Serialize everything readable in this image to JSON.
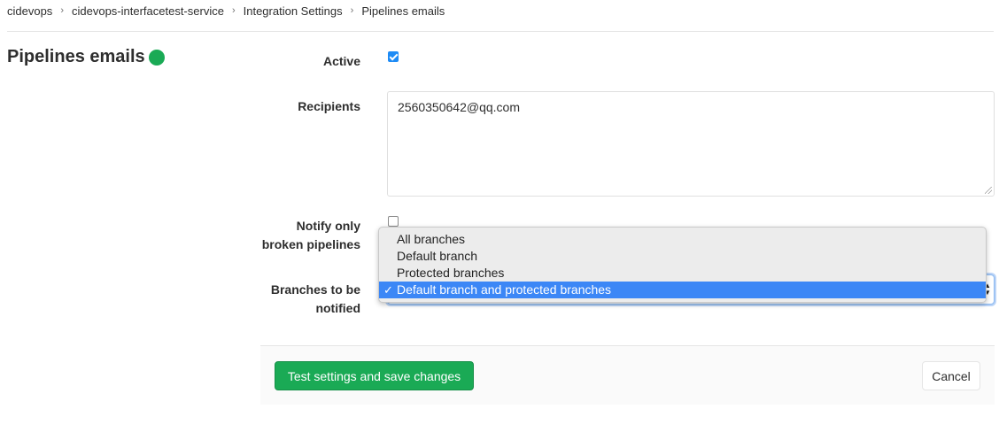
{
  "breadcrumb": {
    "items": [
      "cidevops",
      "cidevops-interfacetest-service",
      "Integration Settings"
    ],
    "current": "Pipelines emails",
    "separator": "›"
  },
  "page": {
    "title": "Pipelines emails",
    "status_color": "#1aaa55"
  },
  "form": {
    "active": {
      "label": "Active",
      "checked": true
    },
    "recipients": {
      "label": "Recipients",
      "value": "2560350642@qq.com"
    },
    "notify_broken": {
      "label_line1": "Notify only",
      "label_line2": "broken pipelines",
      "checked": false
    },
    "branches": {
      "label_line1": "Branches to be",
      "label_line2": "notified",
      "options": [
        "All branches",
        "Default branch",
        "Protected branches",
        "Default branch and protected branches"
      ],
      "selected": "Default branch and protected branches",
      "check_mark": "✓"
    }
  },
  "footer": {
    "save_label": "Test settings and save changes",
    "cancel_label": "Cancel"
  },
  "colors": {
    "accent_green": "#1aaa55",
    "selection_blue": "#3c87f6",
    "checkbox_blue": "#1e8bf5"
  }
}
